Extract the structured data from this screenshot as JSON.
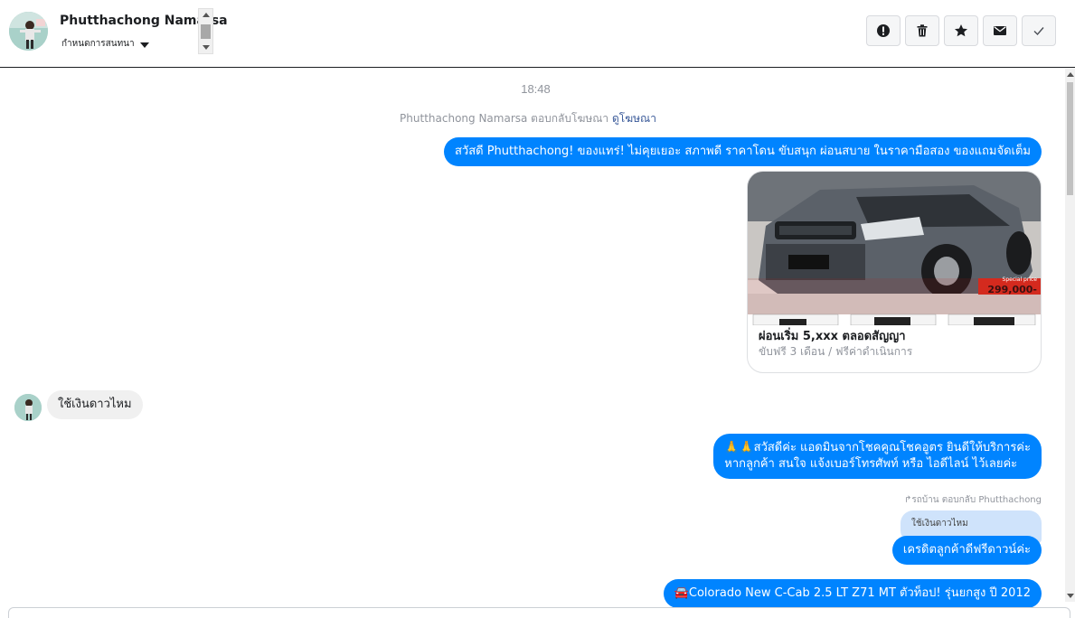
{
  "header": {
    "contact_name": "Phutthachong Namarsa",
    "assign_label": "กำหนดการสนทนา",
    "actions": [
      {
        "name": "report",
        "icon": "exclamation-circle-icon"
      },
      {
        "name": "delete",
        "icon": "trash-icon"
      },
      {
        "name": "star",
        "icon": "star-icon"
      },
      {
        "name": "mark-unread",
        "icon": "envelope-icon"
      },
      {
        "name": "done",
        "icon": "checkmark-icon"
      }
    ]
  },
  "chat": {
    "timestamp": "18:48",
    "ad_reply_note": "Phutthachong Namarsa ตอบกลับโฆษณา",
    "ad_link": "ดูโฆษณา",
    "messages": [
      {
        "side": "out",
        "text": "สวัสดี Phutthachong! ของแทร่! ไม่คุยเยอะ สภาพดี ราคาโดน ขับสนุก ผ่อนสบาย ในราคามือสอง ของแถมจัดเต็ม"
      },
      {
        "side": "in",
        "text": "ใช้เงินดาวไหม"
      },
      {
        "side": "out",
        "line1": "🙏🙏สวัสดีค่ะ แอดมินจากโชคคูณโชคอูตร ยินดีให้บริการค่ะ",
        "line2": "หากลูกค้า สนใจ แจ้งเบอร์โทรศัพท์ หรือ ไอดีไลน์  ไว้เลยค่ะ"
      },
      {
        "side": "out",
        "text": "เครดิตลูกค้าดีฟรีดาวน์ค่ะ"
      },
      {
        "side": "out",
        "text": "🚘Colorado New C-Cab 2.5 LT Z71 MT ตัวท็อป! รุ่นยกสูง ปี 2012"
      }
    ],
    "card": {
      "title": "ผ่อนเริ่ม 5,xxx ตลอดสัญญา",
      "subtitle": "ขับฟรี 3 เดือน / ฟรีค่าดำเนินการ",
      "price_tag": "299,000-",
      "price_label": "Special price"
    },
    "reply_meta": "↱รถบ้าน ตอบกลับ Phutthachong",
    "quoted_text": "ใช้เงินดาวไหม"
  },
  "colors": {
    "outgoing_bubble": "#0084ff",
    "incoming_bubble": "#f0f0f0",
    "quote_bubble": "#cfe3fb",
    "link": "#385898"
  }
}
